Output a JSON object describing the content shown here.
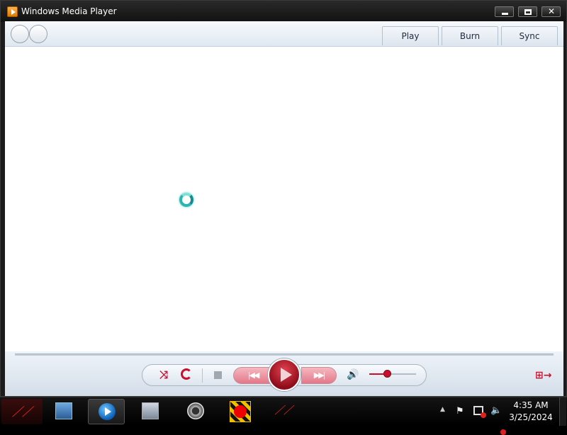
{
  "window": {
    "title": "Windows Media Player",
    "app_icon": "wmp-app-icon",
    "caption_buttons": [
      "minimize-icon",
      "maximize-icon",
      "close-icon"
    ]
  },
  "toolbar": {
    "nav": [
      "back-arrow-icon",
      "forward-arrow-icon"
    ],
    "tabs": [
      {
        "label": "Play"
      },
      {
        "label": "Burn"
      },
      {
        "label": "Sync"
      }
    ]
  },
  "content": {
    "cursor": "busy-spinner-icon"
  },
  "controls": {
    "icons": [
      "shuffle-icon",
      "repeat-icon",
      "stop-icon",
      "previous-icon",
      "play-icon",
      "next-icon",
      "volume-icon",
      "switch-to-now-playing-icon"
    ],
    "volume_level": 0.4,
    "accent_color": "#c8102e"
  },
  "taskbar": {
    "items": [
      "rog-start-orb",
      "explorer-icon",
      "windows-media-player-icon",
      "remote-desktop-icon",
      "camera-icon",
      "screen-recorder-icon",
      "rog-icon"
    ],
    "tray_icons": [
      "show-hidden-icons-arrow",
      "action-center-flag-icon",
      "network-disconnected-icon",
      "volume-muted-icon"
    ],
    "clock": {
      "time": "4:35 AM",
      "date": "3/25/2024"
    }
  }
}
